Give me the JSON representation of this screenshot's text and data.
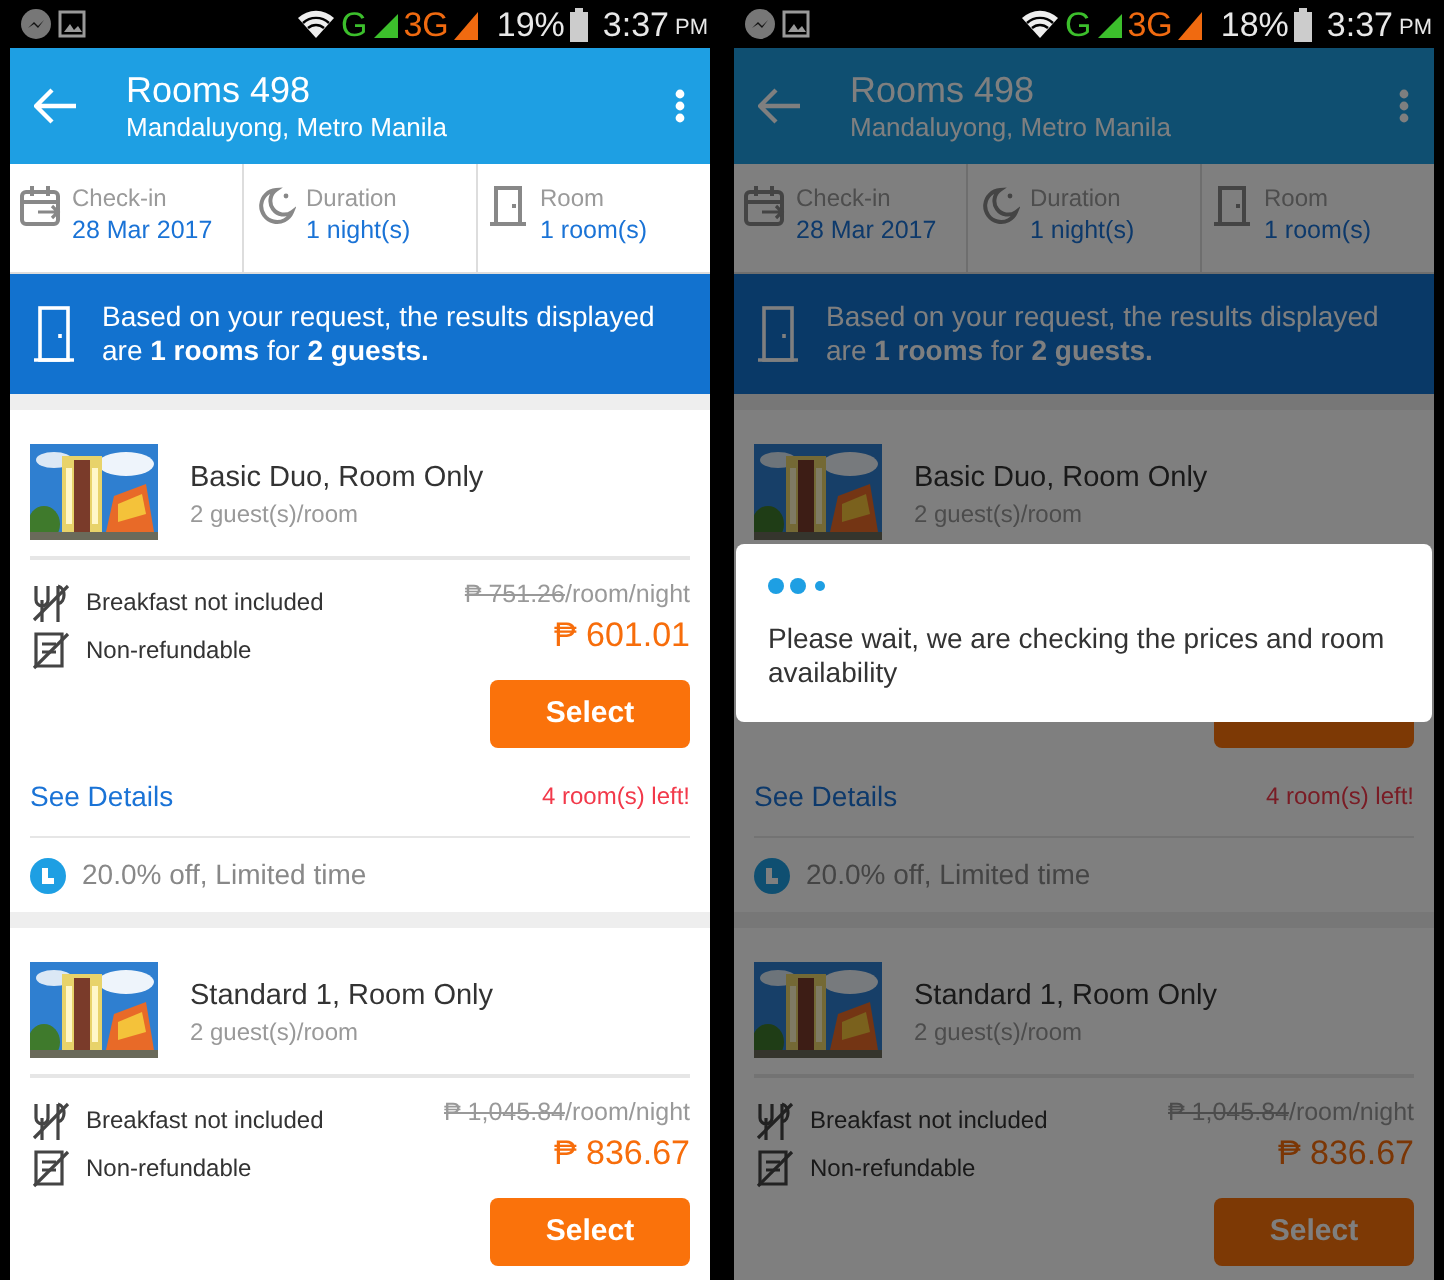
{
  "screens": [
    {
      "status_bar": {
        "network_1": "G",
        "network_2": "3G",
        "battery": "19%",
        "time": "3:37",
        "ampm": "PM"
      },
      "app_bar": {
        "title": "Rooms 498",
        "subtitle": "Mandaluyong, Metro Manila"
      },
      "search_summary": [
        {
          "kind": "calendar",
          "label": "Check-in",
          "value": "28 Mar 2017"
        },
        {
          "kind": "moon",
          "label": "Duration",
          "value": "1 night(s)"
        },
        {
          "kind": "door",
          "label": "Room",
          "value": "1 room(s)"
        }
      ],
      "notice": "Based on your request, the results displayed are **1 rooms** for **2 guests.**",
      "rooms": [
        {
          "name": "Basic Duo, Room Only",
          "guests": "2 guest(s)/room",
          "features": [
            {
              "kind": "breakfast",
              "label": "Breakfast not included"
            },
            {
              "kind": "refund",
              "label": "Non-refundable"
            }
          ],
          "old_price": "₱ 751.26",
          "unit": "/room/night",
          "price": "₱ 601.01",
          "button": "Select",
          "details_link": "See Details",
          "availability": "4 room(s) left!",
          "promo": "20.0% off, Limited time"
        },
        {
          "name": "Standard 1, Room Only",
          "guests": "2 guest(s)/room",
          "features": [
            {
              "kind": "breakfast",
              "label": "Breakfast not included"
            },
            {
              "kind": "refund",
              "label": "Non-refundable"
            }
          ],
          "old_price": "₱ 1,045.84",
          "unit": "/room/night",
          "price": "₱ 836.67",
          "button": "Select"
        }
      ]
    },
    {
      "status_bar": {
        "network_1": "G",
        "network_2": "3G",
        "battery": "18%",
        "time": "3:37",
        "ampm": "PM"
      },
      "app_bar": {
        "title": "Rooms 498",
        "subtitle": "Mandaluyong, Metro Manila"
      },
      "search_summary": [
        {
          "kind": "calendar",
          "label": "Check-in",
          "value": "28 Mar 2017"
        },
        {
          "kind": "moon",
          "label": "Duration",
          "value": "1 night(s)"
        },
        {
          "kind": "door",
          "label": "Room",
          "value": "1 room(s)"
        }
      ],
      "notice": "Based on your request, the results displayed are **1 rooms** for **2 guests.**",
      "rooms": [
        {
          "name": "Basic Duo, Room Only",
          "guests": "2 guest(s)/room",
          "details_link": "See Details",
          "availability": "4 room(s) left!",
          "promo": "20.0% off, Limited time"
        },
        {
          "name": "Standard 1, Room Only",
          "guests": "2 guest(s)/room",
          "features": [
            {
              "kind": "breakfast",
              "label": "Breakfast not included"
            },
            {
              "kind": "refund",
              "label": "Non-refundable"
            }
          ],
          "old_price": "₱ 1,045.84",
          "unit": "/room/night",
          "price": "₱ 836.67",
          "button": "Select"
        }
      ],
      "dialog": {
        "message": "Please wait, we are checking the prices and room availability"
      }
    }
  ]
}
